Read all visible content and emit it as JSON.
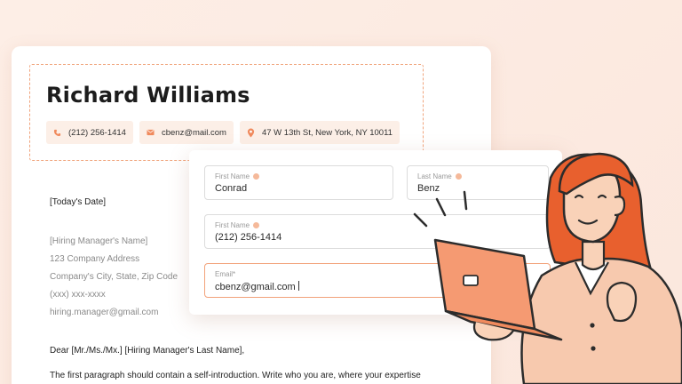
{
  "resume": {
    "name": "Richard Williams",
    "phone": "(212) 256-1414",
    "email": "cbenz@mail.com",
    "address": "47 W 13th St, New York, NY 10011"
  },
  "letter": {
    "date": "[Today's Date]",
    "hiring_manager": "[Hiring Manager's Name]",
    "company_address": "123 Company Address",
    "company_city": "Company's City, State, Zip Code",
    "phone": "(xxx) xxx-xxxx",
    "email": "hiring.manager@gmail.com",
    "salutation": "Dear [Mr./Ms./Mx.] [Hiring Manager's Last Name],",
    "paragraph": "The first paragraph should contain a self-introduction. Write who you are, where your expertise"
  },
  "form": {
    "first_name": {
      "label": "First Name",
      "value": "Conrad"
    },
    "last_name": {
      "label": "Last Name",
      "value": "Benz"
    },
    "phone": {
      "label": "First Name",
      "value": "(212) 256-1414"
    },
    "email": {
      "label": "Email*",
      "value": "cbenz@gmail.com"
    }
  },
  "colors": {
    "accent": "#f08a5d",
    "chip_bg": "#fcefe7",
    "laptop": "#f59a72"
  },
  "icons": [
    "phone-icon",
    "mail-icon",
    "location-pin-icon",
    "info-icon"
  ]
}
